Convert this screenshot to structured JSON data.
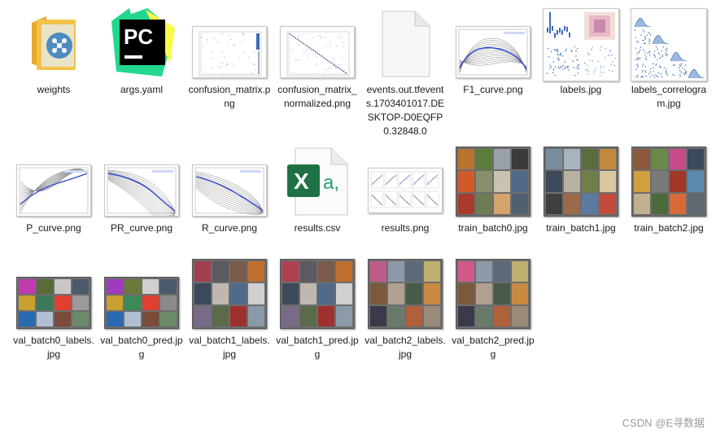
{
  "files": [
    {
      "name": "weights",
      "kind": "folder"
    },
    {
      "name": "args.yaml",
      "kind": "pycharm"
    },
    {
      "name": "confusion_matrix.png",
      "kind": "confusion"
    },
    {
      "name": "confusion_matrix_normalized.png",
      "kind": "confusion_norm"
    },
    {
      "name": "events.out.tfevents.1703401017.DESKTOP-D0EQFP0.32848.0",
      "kind": "blank"
    },
    {
      "name": "F1_curve.png",
      "kind": "curve_f1"
    },
    {
      "name": "labels.jpg",
      "kind": "labels"
    },
    {
      "name": "labels_correlogram.jpg",
      "kind": "correlogram"
    },
    {
      "name": "P_curve.png",
      "kind": "curve_p"
    },
    {
      "name": "PR_curve.png",
      "kind": "curve_pr"
    },
    {
      "name": "R_curve.png",
      "kind": "curve_r"
    },
    {
      "name": "results.csv",
      "kind": "excel"
    },
    {
      "name": "results.png",
      "kind": "results"
    },
    {
      "name": "train_batch0.jpg",
      "kind": "batch",
      "palette": [
        "#b9742f",
        "#5b7d3a",
        "#9aa0a8",
        "#3a3a3a",
        "#d05a2a",
        "#888f6b",
        "#c9c2b0",
        "#4e6a86",
        "#a83b2c",
        "#6c7d55",
        "#d4a46a",
        "#506070"
      ]
    },
    {
      "name": "train_batch1.jpg",
      "kind": "batch",
      "palette": [
        "#7a8f9e",
        "#a7b4c0",
        "#5e6b40",
        "#c2893e",
        "#3c4a5a",
        "#b8b0a0",
        "#6f7f4a",
        "#d8c8a0",
        "#3f3f3f",
        "#9a6a4a",
        "#5a7aa0",
        "#c24a3a"
      ]
    },
    {
      "name": "train_batch2.jpg",
      "kind": "batch",
      "palette": [
        "#8a5a3a",
        "#6a8a4a",
        "#c84a8a",
        "#3a4a5a",
        "#d0a040",
        "#7a7a7a",
        "#a0382a",
        "#5a8ab0",
        "#c0b090",
        "#4a6a3a",
        "#d86a3a",
        "#606870"
      ]
    },
    {
      "name": "val_batch0_labels.jpg",
      "kind": "batch_val",
      "palette": [
        "#c03ab0",
        "#5a6a3a",
        "#c8c8c8",
        "#4a5a6a",
        "#c8a030",
        "#3a7a5a",
        "#e04030",
        "#9a9a9a",
        "#2a6ab0",
        "#b0c0d0",
        "#7a4a3a",
        "#6a8a6a"
      ]
    },
    {
      "name": "val_batch0_pred.jpg",
      "kind": "batch_val",
      "palette": [
        "#a03ac0",
        "#6a7a3a",
        "#d0d0d0",
        "#4a5a6a",
        "#c8a030",
        "#3a8a5a",
        "#e04030",
        "#8a8a8a",
        "#2a6ab0",
        "#b0c0d0",
        "#7a4a3a",
        "#6a8a6a"
      ]
    },
    {
      "name": "val_batch1_labels.jpg",
      "kind": "batch",
      "palette": [
        "#a04050",
        "#5a5a60",
        "#7a5a4a",
        "#c07030",
        "#3a4a5a",
        "#c0b8b0",
        "#506a8a",
        "#d0d0d0",
        "#7a6a8a",
        "#5a6a4a",
        "#a03030",
        "#8a9aa8"
      ]
    },
    {
      "name": "val_batch1_pred.jpg",
      "kind": "batch",
      "palette": [
        "#b04050",
        "#5a5a60",
        "#7a5a4a",
        "#c07030",
        "#3a4a5a",
        "#c0b8b0",
        "#506a8a",
        "#d0d0d0",
        "#7a6a8a",
        "#5a6a4a",
        "#a03030",
        "#8a9aa8"
      ]
    },
    {
      "name": "val_batch2_labels.jpg",
      "kind": "batch",
      "palette": [
        "#c05a8a",
        "#8a9aa8",
        "#5a6a7a",
        "#c0b070",
        "#7a5a3a",
        "#b0a090",
        "#4a5a4a",
        "#c88a40",
        "#3a3a4a",
        "#6a7a6a",
        "#b0603a",
        "#9a8a7a"
      ]
    },
    {
      "name": "val_batch2_pred.jpg",
      "kind": "batch",
      "palette": [
        "#d05a8a",
        "#8a9aa8",
        "#5a6a7a",
        "#c0b070",
        "#7a5a3a",
        "#b0a090",
        "#4a5a4a",
        "#c88a40",
        "#3a3a4a",
        "#6a7a6a",
        "#b0603a",
        "#9a8a7a"
      ]
    }
  ],
  "icons": {
    "pycharm_letters": "PC",
    "excel_letter": "X",
    "excel_glyph": "a,"
  },
  "colors": {
    "folder": "#f3c24a",
    "pycharm_green": "#22d88f",
    "excel_green": "#1e7145",
    "curve_blue": "#3048d0"
  },
  "watermark": "CSDN @E寻数据"
}
